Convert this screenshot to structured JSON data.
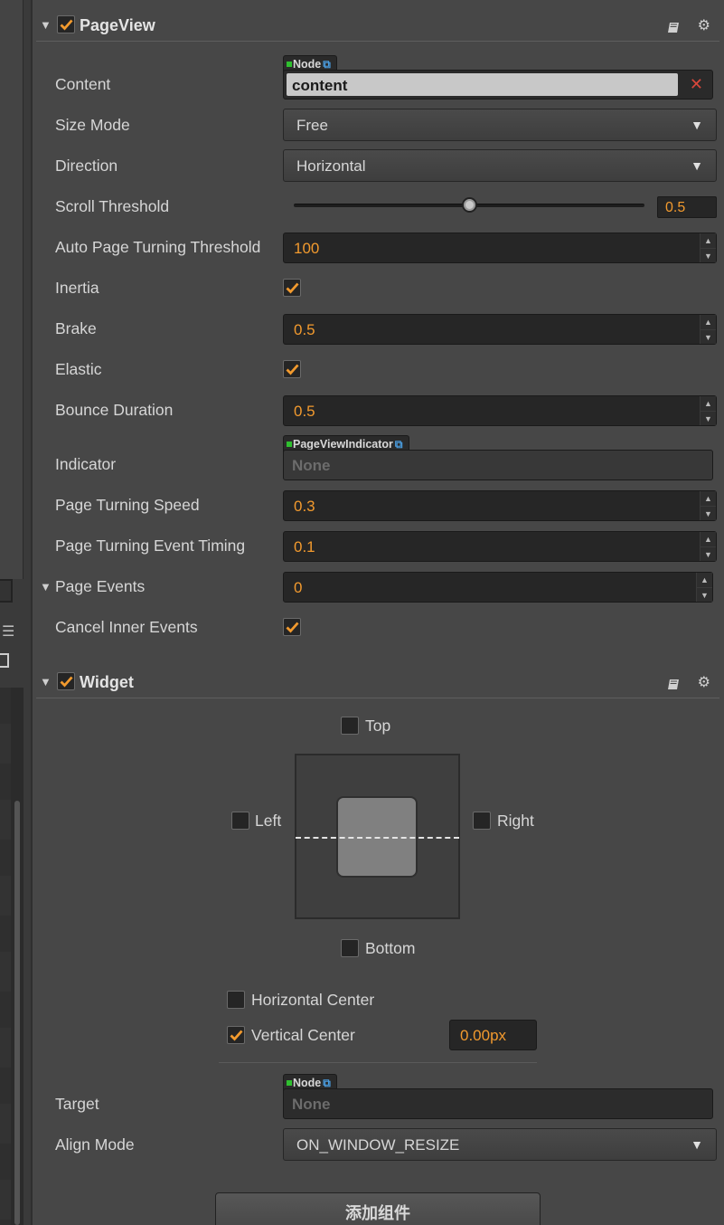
{
  "pageview": {
    "title": "PageView",
    "enabled": true,
    "content_tag": "Node",
    "content_value": "content",
    "props": {
      "content": "Content",
      "size_mode": "Size Mode",
      "direction": "Direction",
      "scroll_threshold": "Scroll Threshold",
      "auto_page_turning": "Auto Page Turning Threshold",
      "inertia": "Inertia",
      "brake": "Brake",
      "elastic": "Elastic",
      "bounce_duration": "Bounce Duration",
      "indicator": "Indicator",
      "page_turning_speed": "Page Turning Speed",
      "page_turning_event_timing": "Page Turning Event Timing",
      "page_events": "Page Events",
      "cancel_inner_events": "Cancel Inner Events"
    },
    "values": {
      "size_mode": "Free",
      "direction": "Horizontal",
      "scroll_threshold": "0.5",
      "scroll_threshold_fraction": 0.5,
      "auto_page_turning": "100",
      "inertia": true,
      "brake": "0.5",
      "elastic": true,
      "bounce_duration": "0.5",
      "indicator_tag": "PageViewIndicator",
      "indicator": "None",
      "page_turning_speed": "0.3",
      "page_turning_event_timing": "0.1",
      "page_events": "0",
      "cancel_inner_events": true
    }
  },
  "widget": {
    "title": "Widget",
    "enabled": true,
    "top": "Top",
    "left": "Left",
    "right": "Right",
    "bottom": "Bottom",
    "horizontal_center": "Horizontal Center",
    "vertical_center": "Vertical Center",
    "vertical_center_checked": true,
    "vertical_center_value": "0.00px",
    "target_label": "Target",
    "target_tag": "Node",
    "target_value": "None",
    "align_mode_label": "Align Mode",
    "align_mode_value": "ON_WINDOW_RESIZE"
  },
  "add_component": "添加组件",
  "icons": {
    "collapse": "triangle-down-icon",
    "help": "book-icon",
    "settings": "gear-icon",
    "remove": "close-icon",
    "link": "external-link-icon",
    "menu": "hamburger-icon"
  },
  "colors": {
    "accent": "#f29a2e",
    "node_dot": "#2fbf2f",
    "link": "#4a9de0",
    "remove": "#d9473b"
  }
}
